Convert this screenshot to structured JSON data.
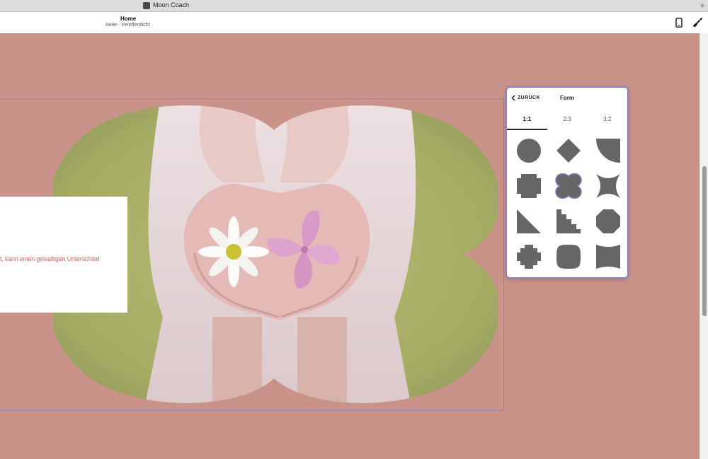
{
  "browser": {
    "tab_title": "Moon Coach"
  },
  "header": {
    "page_name": "Home",
    "page_status": "Seite · Veröffentlicht"
  },
  "canvas": {
    "text_snippet": "t, kann einen gewaltigen Unterschied",
    "background_color": "#c9938a"
  },
  "panel": {
    "back_label": "ZURÜCK",
    "title": "Form",
    "tabs": [
      {
        "label": "1:1",
        "active": true
      },
      {
        "label": "2:3",
        "active": false
      },
      {
        "label": "3:2",
        "active": false
      }
    ],
    "shapes": [
      "circle",
      "diamond",
      "quarter-circle",
      "cross-rounded",
      "flower",
      "concave-star",
      "triangle",
      "stairs",
      "octagon",
      "plus-cross",
      "squircle",
      "bowtie"
    ],
    "selected_shape": "flower",
    "accent_color": "#8b7fc4",
    "shape_color": "#666666"
  },
  "icons": {
    "mobile": "mobile-phone-icon",
    "design": "paintbrush-icon",
    "back": "chevron-left-icon"
  }
}
